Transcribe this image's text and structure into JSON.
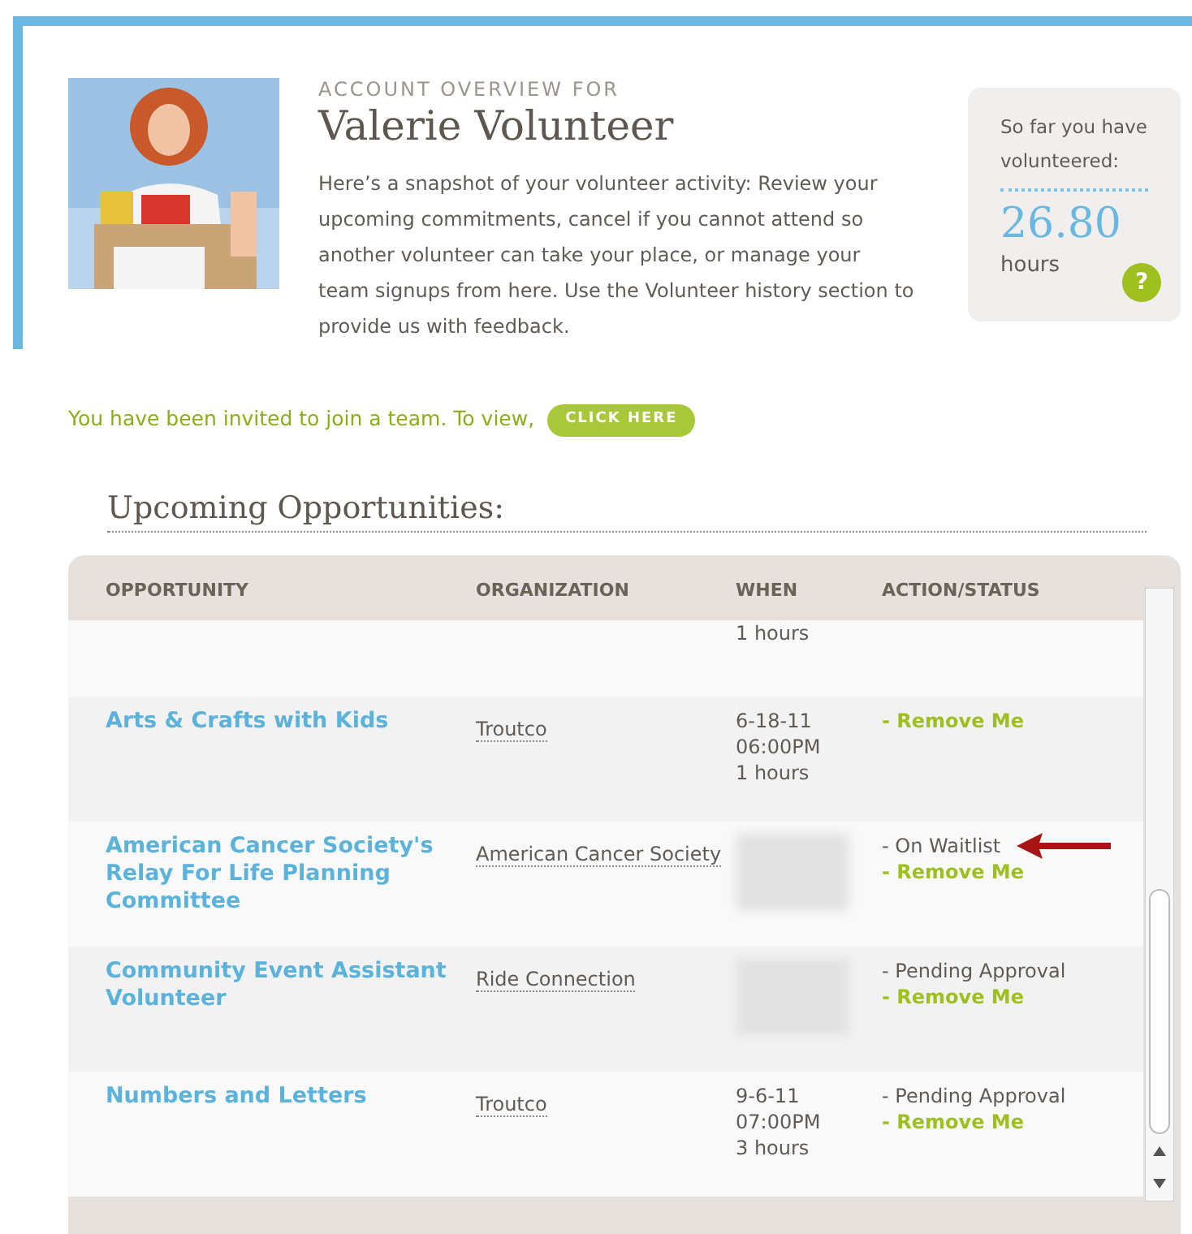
{
  "overview": {
    "eyebrow": "ACCOUNT OVERVIEW FOR",
    "name": "Valerie Volunteer",
    "intro": "Here’s a snapshot of your volunteer activity: Review your upcoming commitments, cancel if you cannot attend so another volunteer can take your place, or manage your team signups from here. Use the Volunteer history section to provide us with feedback."
  },
  "stats": {
    "label": "So far you have volunteered:",
    "value": "26.80",
    "unit": "hours",
    "help": "?"
  },
  "invite": {
    "text": "You have been invited to join a team. To view,",
    "button": "CLICK HERE"
  },
  "section_title": "Upcoming Opportunities:",
  "table": {
    "columns": [
      "OPPORTUNITY",
      "ORGANIZATION",
      "WHEN",
      "ACTION/STATUS"
    ],
    "rows": [
      {
        "opportunity": "",
        "organization": "",
        "when": [
          "1 hours"
        ],
        "blurred": false,
        "status": "",
        "action": "",
        "arrow": false
      },
      {
        "opportunity": "Arts & Crafts with Kids",
        "organization": "Troutco",
        "when": [
          "6-18-11",
          "06:00PM",
          "1 hours"
        ],
        "blurred": false,
        "status": "",
        "action": "- Remove Me",
        "arrow": false
      },
      {
        "opportunity": "American Cancer Society's Relay For Life Planning Committee",
        "organization": "American Cancer Society",
        "when": [],
        "blurred": true,
        "status": "- On Waitlist",
        "action": "- Remove Me",
        "arrow": true
      },
      {
        "opportunity": "Community Event Assistant Volunteer",
        "organization": "Ride Connection",
        "when": [],
        "blurred": true,
        "status": "- Pending Approval",
        "action": "- Remove Me",
        "arrow": false
      },
      {
        "opportunity": "Numbers and Letters",
        "organization": "Troutco",
        "when": [
          "9-6-11",
          "07:00PM",
          "3 hours"
        ],
        "blurred": false,
        "status": "- Pending Approval",
        "action": "- Remove Me",
        "arrow": false
      }
    ]
  }
}
